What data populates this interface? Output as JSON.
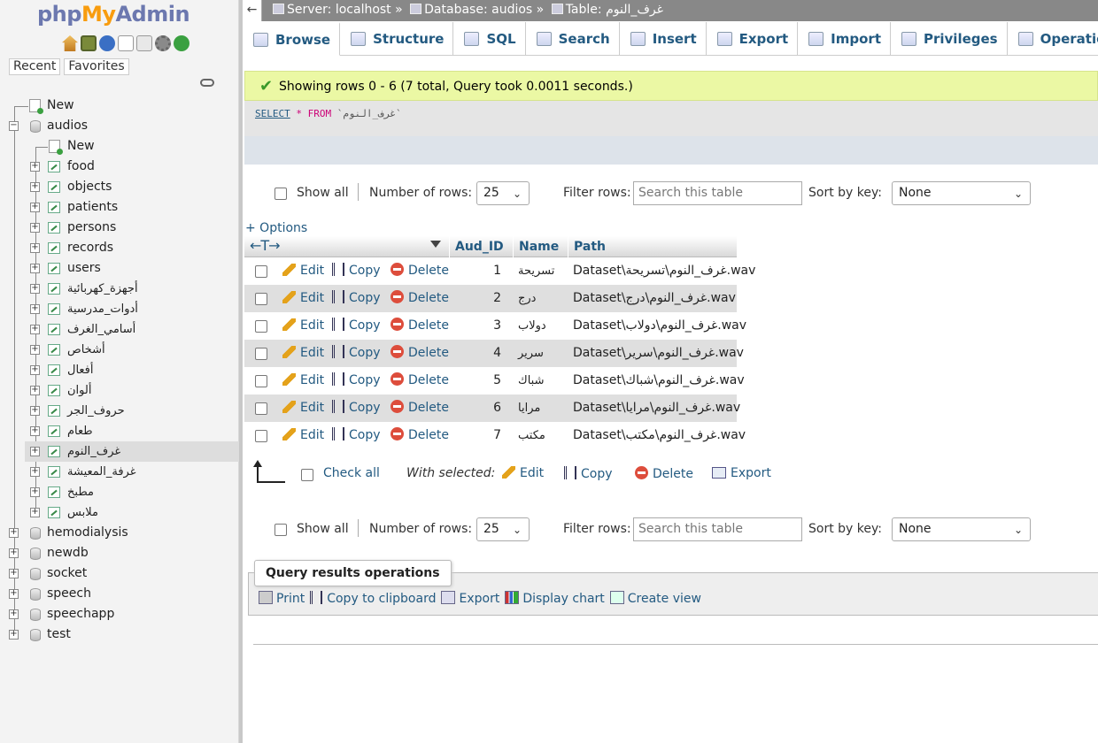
{
  "logo": {
    "php": "php",
    "my": "My",
    "admin": "Admin"
  },
  "nav": {
    "icons": [
      "home-icon",
      "exit-icon",
      "help-icon",
      "docs-icon",
      "sql-docs-icon",
      "settings-icon",
      "reload-icon"
    ],
    "recent_tab": "Recent",
    "favorites_tab": "Favorites",
    "tree": {
      "new_root": "New",
      "audios": "audios",
      "audios_new": "New",
      "audios_tables": [
        "food",
        "objects",
        "patients",
        "persons",
        "records",
        "users",
        "أجهزة_كهربائية",
        "أدوات_مدرسية",
        "أسامي_الغرف",
        "أشخاص",
        "أفعال",
        "ألوان",
        "حروف_الجر",
        "طعام",
        "غرف_النوم",
        "غرفة_المعيشة",
        "مطبخ",
        "ملابس"
      ],
      "other_dbs": [
        "hemodialysis",
        "newdb",
        "socket",
        "speech",
        "speechapp",
        "test"
      ]
    }
  },
  "breadcrumb": {
    "back": "←",
    "server": "Server: localhost »",
    "database": "Database: audios »",
    "table": "Table: غرف_النوم"
  },
  "menu": {
    "tabs": [
      {
        "label": "Browse",
        "icon": "browse-icon"
      },
      {
        "label": "Structure",
        "icon": "structure-icon"
      },
      {
        "label": "SQL",
        "icon": "sql-icon"
      },
      {
        "label": "Search",
        "icon": "search-icon"
      },
      {
        "label": "Insert",
        "icon": "insert-icon"
      },
      {
        "label": "Export",
        "icon": "export-icon"
      },
      {
        "label": "Import",
        "icon": "import-icon"
      },
      {
        "label": "Privileges",
        "icon": "privileges-icon"
      },
      {
        "label": "Operations",
        "icon": "operations-icon"
      }
    ]
  },
  "message": {
    "text": "Showing rows 0 - 6 (7 total, Query took 0.0011 seconds.)"
  },
  "sql": {
    "select": "SELECT",
    "star": "*",
    "from": "FROM",
    "table": "`غرف_النوم`"
  },
  "navbar": {
    "show_all": "Show all",
    "num_rows_label": "Number of rows:",
    "num_rows_value": "25",
    "filter_label": "Filter rows:",
    "filter_placeholder": "Search this table",
    "sort_label": "Sort by key:",
    "sort_value": "None"
  },
  "options_link": "+ Options",
  "table": {
    "arrows": "←T→",
    "columns": [
      "Aud_ID",
      "Name",
      "Path"
    ],
    "actions": {
      "edit": "Edit",
      "copy": "Copy",
      "delete": "Delete"
    },
    "rows": [
      {
        "id": "1",
        "name": "تسريحة",
        "path": "Dataset\\غرف_النوم\\تسريحة.wav"
      },
      {
        "id": "2",
        "name": "درج",
        "path": "Dataset\\غرف_النوم\\درج.wav"
      },
      {
        "id": "3",
        "name": "دولاب",
        "path": "Dataset\\غرف_النوم\\دولاب.wav"
      },
      {
        "id": "4",
        "name": "سرير",
        "path": "Dataset\\غرف_النوم\\سرير.wav"
      },
      {
        "id": "5",
        "name": "شباك",
        "path": "Dataset\\غرف_النوم\\شباك.wav"
      },
      {
        "id": "6",
        "name": "مرايا",
        "path": "Dataset\\غرف_النوم\\مرايا.wav"
      },
      {
        "id": "7",
        "name": "مكتب",
        "path": "Dataset\\غرف_النوم\\مكتب.wav"
      }
    ]
  },
  "with_selected": {
    "check_all": "Check all",
    "label": "With selected:",
    "edit": "Edit",
    "copy": "Copy",
    "delete": "Delete",
    "export": "Export"
  },
  "query_ops": {
    "legend": "Query results operations",
    "print": "Print",
    "copy_clipboard": "Copy to clipboard",
    "export": "Export",
    "display_chart": "Display chart",
    "create_view": "Create view"
  }
}
